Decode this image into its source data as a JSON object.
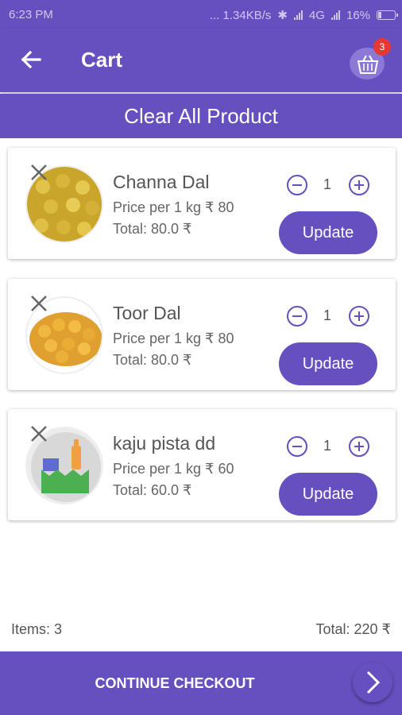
{
  "status_bar": {
    "time": "6:23 PM",
    "network_speed": "... 1.34KB/s",
    "network_type": "4G",
    "battery": "16%"
  },
  "app_bar": {
    "title": "Cart",
    "cart_badge_count": "3"
  },
  "clear_all_label": "Clear All Product",
  "cart_items": [
    {
      "name": "Channa Dal",
      "price": "Price per 1 kg ₹ 80",
      "total": "Total: 80.0 ₹",
      "quantity": "1",
      "update_label": "Update",
      "image": "channa-dal-image"
    },
    {
      "name": "Toor Dal",
      "price": "Price per 1 kg ₹ 80",
      "total": "Total: 80.0 ₹",
      "quantity": "1",
      "update_label": "Update",
      "image": "toor-dal-image"
    },
    {
      "name": "kaju pista dd",
      "price": "Price per 1 kg ₹ 60",
      "total": "Total: 60.0 ₹",
      "quantity": "1",
      "update_label": "Update",
      "image": "grocery-placeholder-image"
    }
  ],
  "summary": {
    "items": "Items: 3",
    "total": "Total: 220 ₹"
  },
  "checkout": {
    "label": "CONTINUE CHECKOUT"
  },
  "colors": {
    "primary": "#6650c0",
    "badge": "#e53935",
    "white": "#ffffff"
  }
}
